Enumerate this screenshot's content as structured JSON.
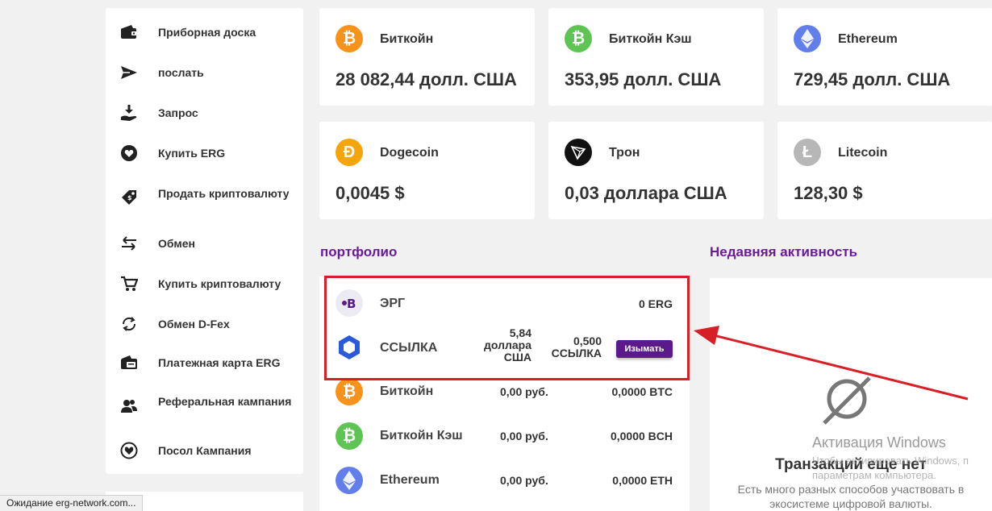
{
  "sidebar": {
    "items": [
      {
        "label": "Приборная доска",
        "icon": "wallet-icon"
      },
      {
        "label": "послать",
        "icon": "send-icon"
      },
      {
        "label": "Запрос",
        "icon": "request-icon"
      },
      {
        "label": "Купить ERG",
        "icon": "heart-icon"
      },
      {
        "label": "Продать криптовалюту",
        "icon": "tag-icon"
      },
      {
        "label": "Обмен",
        "icon": "exchange-icon"
      },
      {
        "label": "Купить криптовалюту",
        "icon": "cart-icon"
      },
      {
        "label": "Обмен D-Fex",
        "icon": "refresh-icon"
      },
      {
        "label": "Платежная карта ERG",
        "icon": "card-icon"
      },
      {
        "label": "Реферальная кампания",
        "icon": "users-icon"
      },
      {
        "label": "Посол Кампания",
        "icon": "heart-hand-icon"
      }
    ]
  },
  "prices": [
    {
      "name": "Биткойн",
      "price": "28 082,44 долл. США",
      "symbol": "₿",
      "color": "#f7931a"
    },
    {
      "name": "Биткойн Кэш",
      "price": "353,95 долл. США",
      "symbol": "₿",
      "color": "#5ec554"
    },
    {
      "name": "Ethereum",
      "price": "729,45 долл. США",
      "symbol": "◆",
      "color": "#627eea"
    },
    {
      "name": "Dogecoin",
      "price": "0,0045 $",
      "symbol": "Ð",
      "color": "#f5a50c"
    },
    {
      "name": "Трон",
      "price": "0,03 доллара США",
      "symbol": "◬",
      "color": "#111111"
    },
    {
      "name": "Litecoin",
      "price": "128,30 $",
      "symbol": "Ł",
      "color": "#b7b7b7"
    }
  ],
  "portfolio": {
    "title": "портфолио",
    "rows": [
      {
        "name": "ЭРГ",
        "fiat": "",
        "crypto": "0 ERG",
        "icon": "erg-icon"
      },
      {
        "name": "ССЫЛКА",
        "fiat": "5,84 доллара США",
        "crypto": "0,500 ССЫЛКА",
        "icon": "chainlink-icon"
      },
      {
        "name": "Биткойн",
        "fiat": "0,00 руб.",
        "crypto": "0,0000 BTC",
        "icon": "bitcoin-icon"
      },
      {
        "name": "Биткойн Кэш",
        "fiat": "0,00 руб.",
        "crypto": "0,0000 BCH",
        "icon": "bitcoin-cash-icon"
      },
      {
        "name": "Ethereum",
        "fiat": "0,00 руб.",
        "crypto": "0,0000 ETH",
        "icon": "ethereum-icon"
      }
    ],
    "withdraw_label": "Изымать"
  },
  "activity": {
    "title": "Недавняя активность",
    "empty_title": "Транзакций еще нет",
    "empty_desc": "Есть много разных способов участвовать в экосистеме цифровой валюты."
  },
  "watermark": {
    "line1": "Активация Windows",
    "line2": "Чтобы активировать Windows, п",
    "line3": "параметрам компьютера."
  },
  "status_bar": "Ожидание erg-network.com...",
  "colors": {
    "accent": "#6a1b9a",
    "button": "#5b1a8c",
    "highlight": "#d61f26"
  }
}
